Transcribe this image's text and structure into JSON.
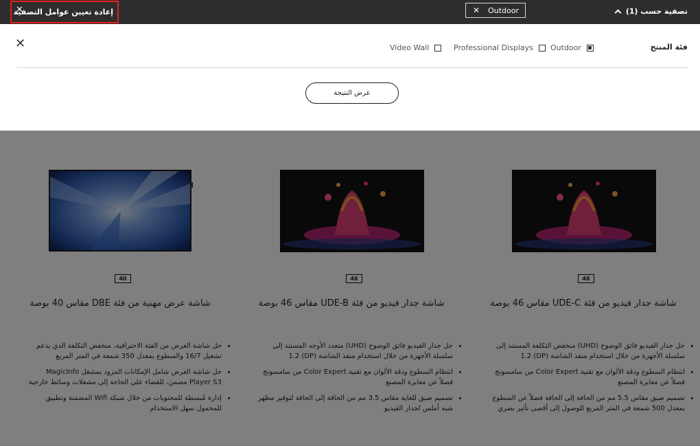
{
  "topbar": {
    "reset_label": "إعادة تعيين عوامل التصفية",
    "active_chip": "Outdoor",
    "filter_by_label": "تصفية حسب (1)"
  },
  "filter_panel": {
    "category_title": "فئة المنتج",
    "options": [
      {
        "label": "Outdoor",
        "checked": true
      },
      {
        "label": "Professional Displays",
        "checked": false
      },
      {
        "label": "Video Wall",
        "checked": false
      }
    ],
    "show_results_label": "عرض النتيجة"
  },
  "products": [
    {
      "size": "46",
      "image": "paint-splash-display-icon",
      "title": "شاشة جدار فيديو من فئة UDE-C مقاس 46 بوصة",
      "features": [
        "حل جدار الفيديو فائق الوضوح (UHD) منخفض التكلفة المستند إلى سلسلة الأجهزة من خلال استخدام منفذ الشاشة (DP) 1.2",
        "انتظام السطوع ودقة الألوان مع تقنية Color Expert من سامسونج فضلاً عن معايرة المصنع",
        "تصميم ضيق مقاس 5.5 مم من الحافة إلى الحافة فضلاً عن السطوع بمعدل 500 شمعة في المتر المربع للوصول إلى أقصى تأثير بصري"
      ]
    },
    {
      "size": "46",
      "image": "paint-splash-display-icon",
      "title": "شاشة جدار فيديو من فئة UDE-B مقاس 46 بوصة",
      "features": [
        "حل جدار الفيديو فائق الوضوح (UHD) متعدد الأوجه المستند إلى سلسلة الأجهزة من خلال استخدام منفذ الشاشة (DP) 1.2",
        "انتظام السطوع ودقة الألوان مع تقنية Color Expert من سامسونج فضلاً عن معايرة المصنع",
        "تصميم ضيق للغاية مقاس 3.5 مم من الحافة إلى الحافة لتوفير مظهر شبه أملس لجدار الفيديو"
      ]
    },
    {
      "size": "40",
      "image": "blue-light-display-icon",
      "title": "شاشة عرض مهنية من فئة DBE مقاس 40 بوصة",
      "features": [
        "حل شاشة العرض من الفئة الاحترافية، منخفض التكلفة الذي يدعم تشغيل 16/7 والسطوع بمعدل 350 شمعة في المتر المربع",
        "حل شاشة العرض شامل الإمكانات المزود بمشغل MagicInfo Player S3 مضمن، للقضاء على الحاجة إلى مشغلات وسائط خارجية",
        "إدارة مُبسطة للمحتويات من خلال شبكة Wifi المضمنة وتطبيق للمحمول سهل الاستخدام"
      ]
    }
  ]
}
